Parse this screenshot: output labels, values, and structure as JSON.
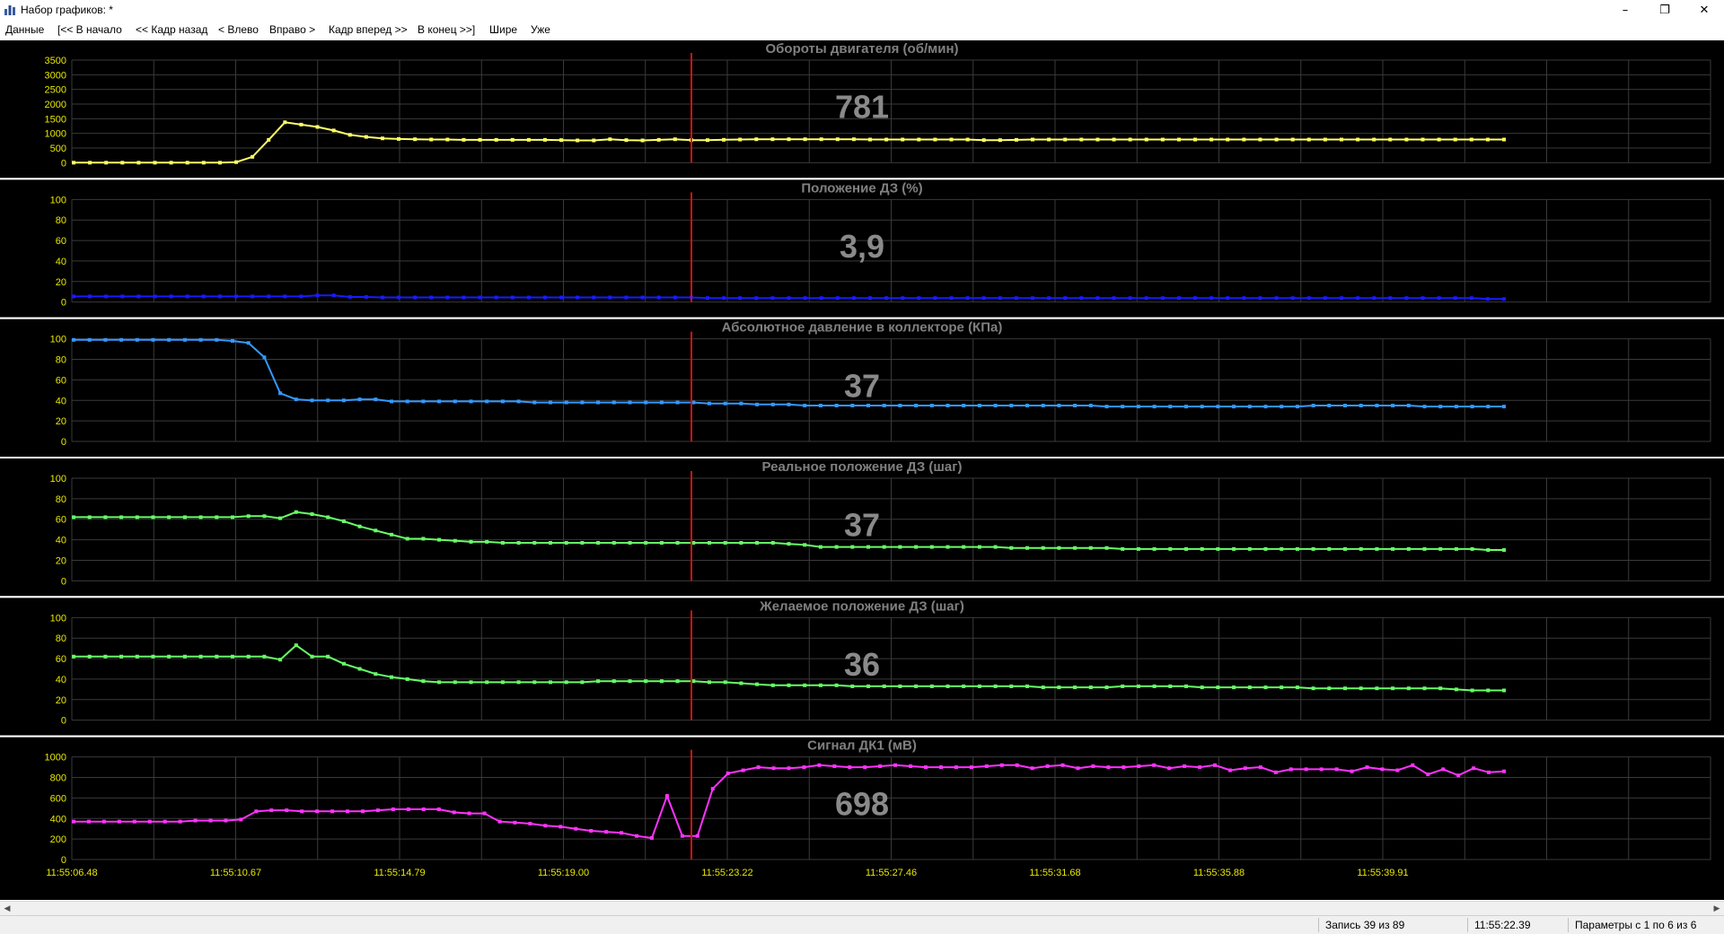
{
  "window": {
    "title": "Набор графиков: *",
    "app_icon": "bar-chart-icon",
    "controls": [
      "minimize-icon",
      "restore-icon",
      "close-icon"
    ]
  },
  "menu": [
    "Данные",
    "[<< В начало",
    "<< Кадр назад",
    "< Влево",
    "Вправо >",
    "Кадр вперед >>",
    "В конец >>]",
    "Шире",
    "Уже"
  ],
  "colors": {
    "plot_background": "#000000",
    "grid": "#3a3a3a",
    "cursor": "#d01010",
    "title_text": "#808080",
    "value_text": "#8a8a8a",
    "tick_text": "#e8e800"
  },
  "cursor_time": "11:55:22.39",
  "x_ticks": [
    "11:55:06.48",
    "11:55:10.67",
    "11:55:14.79",
    "11:55:19.00",
    "11:55:23.22",
    "11:55:27.46",
    "11:55:31.68",
    "11:55:35.88",
    "11:55:39.91"
  ],
  "chart_data": [
    {
      "type": "line",
      "title": "Обороты двигателя  (об/мин)",
      "current_value": "781",
      "color": "#ffff66",
      "ylim": [
        0,
        3500
      ],
      "yticks": [
        0,
        500,
        1000,
        1500,
        2000,
        2500,
        3000,
        3500
      ],
      "x": [
        "11:55:06.48",
        "11:55:10.67",
        "11:55:14.79",
        "11:55:19.00",
        "11:55:23.22",
        "11:55:27.46",
        "11:55:31.68",
        "11:55:35.88",
        "11:55:39.91"
      ],
      "values": [
        0,
        0,
        0,
        0,
        0,
        0,
        0,
        0,
        0,
        0,
        20,
        200,
        780,
        1380,
        1300,
        1220,
        1100,
        950,
        880,
        830,
        810,
        800,
        790,
        790,
        780,
        780,
        780,
        780,
        780,
        780,
        770,
        760,
        760,
        800,
        770,
        760,
        780,
        800,
        770,
        770,
        781,
        790,
        800,
        800,
        800,
        800,
        800,
        800,
        800,
        790,
        790,
        790,
        790,
        790,
        790,
        790,
        770,
        770,
        780,
        790,
        790,
        790,
        790,
        790,
        790,
        790,
        790,
        790,
        790,
        790,
        790,
        790,
        790,
        790,
        790,
        790,
        790,
        790,
        790,
        790,
        790,
        790,
        790,
        790,
        790,
        790,
        790,
        790,
        790
      ]
    },
    {
      "type": "line",
      "title": "Положение ДЗ  (%)",
      "current_value": "3,9",
      "color": "#1a1aff",
      "ylim": [
        0,
        100
      ],
      "yticks": [
        0,
        20,
        40,
        60,
        80,
        100
      ],
      "values": [
        5.5,
        5.5,
        5.5,
        5.5,
        5.5,
        5.5,
        5.5,
        5.5,
        5.5,
        5.5,
        5.5,
        5.5,
        5.5,
        5.5,
        5.5,
        6.5,
        6.5,
        5,
        5,
        4.5,
        4.5,
        4.5,
        4.5,
        4.5,
        4.5,
        4.5,
        4.5,
        4.5,
        4.5,
        4.5,
        4.5,
        4.5,
        4.5,
        4.5,
        4.5,
        4.5,
        4.5,
        4.5,
        4.5,
        3.9,
        3.9,
        3.9,
        3.9,
        3.9,
        3.9,
        3.9,
        3.9,
        3.9,
        3.9,
        3.9,
        3.9,
        3.9,
        3.9,
        3.9,
        3.9,
        3.9,
        3.9,
        3.9,
        3.9,
        3.9,
        3.9,
        3.9,
        3.9,
        3.9,
        3.9,
        3.9,
        3.9,
        3.9,
        3.9,
        3.9,
        3.9,
        3.9,
        3.9,
        3.9,
        3.9,
        3.9,
        3.9,
        3.9,
        3.9,
        3.9,
        3.9,
        3.9,
        3.9,
        3.9,
        3.9,
        3.9,
        3.9,
        3,
        3
      ]
    },
    {
      "type": "line",
      "title": "Абсолютное давление в коллекторе  (КПа)",
      "current_value": "37",
      "color": "#3399ff",
      "ylim": [
        0,
        100
      ],
      "yticks": [
        0,
        20,
        40,
        60,
        80,
        100
      ],
      "values": [
        99,
        99,
        99,
        99,
        99,
        99,
        99,
        99,
        99,
        99,
        98,
        96,
        82,
        47,
        41,
        40,
        40,
        40,
        41,
        41,
        39,
        39,
        39,
        39,
        39,
        39,
        39,
        39,
        39,
        38,
        38,
        38,
        38,
        38,
        38,
        38,
        38,
        38,
        38,
        38,
        37,
        37,
        37,
        36,
        36,
        36,
        35,
        35,
        35,
        35,
        35,
        35,
        35,
        35,
        35,
        35,
        35,
        35,
        35,
        35,
        35,
        35,
        35,
        35,
        35,
        34,
        34,
        34,
        34,
        34,
        34,
        34,
        34,
        34,
        34,
        34,
        34,
        34,
        35,
        35,
        35,
        35,
        35,
        35,
        35,
        34,
        34,
        34,
        34,
        34,
        34
      ]
    },
    {
      "type": "line",
      "title": "Реальное положение ДЗ  (шаг)",
      "current_value": "37",
      "color": "#66ff66",
      "ylim": [
        0,
        100
      ],
      "yticks": [
        0,
        20,
        40,
        60,
        80,
        100
      ],
      "values": [
        62,
        62,
        62,
        62,
        62,
        62,
        62,
        62,
        62,
        62,
        62,
        63,
        63,
        61,
        67,
        65,
        62,
        58,
        53,
        49,
        45,
        41,
        41,
        40,
        39,
        38,
        38,
        37,
        37,
        37,
        37,
        37,
        37,
        37,
        37,
        37,
        37,
        37,
        37,
        37,
        37,
        37,
        37,
        37,
        37,
        36,
        35,
        33,
        33,
        33,
        33,
        33,
        33,
        33,
        33,
        33,
        33,
        33,
        33,
        32,
        32,
        32,
        32,
        32,
        32,
        32,
        31,
        31,
        31,
        31,
        31,
        31,
        31,
        31,
        31,
        31,
        31,
        31,
        31,
        31,
        31,
        31,
        31,
        31,
        31,
        31,
        31,
        31,
        31,
        30,
        30
      ]
    },
    {
      "type": "line",
      "title": "Желаемое положение ДЗ  (шаг)",
      "current_value": "36",
      "color": "#66ff66",
      "ylim": [
        0,
        100
      ],
      "yticks": [
        0,
        20,
        40,
        60,
        80,
        100
      ],
      "values": [
        62,
        62,
        62,
        62,
        62,
        62,
        62,
        62,
        62,
        62,
        62,
        62,
        62,
        59,
        73,
        62,
        62,
        55,
        50,
        45,
        42,
        40,
        38,
        37,
        37,
        37,
        37,
        37,
        37,
        37,
        37,
        37,
        37,
        38,
        38,
        38,
        38,
        38,
        38,
        38,
        37,
        37,
        36,
        35,
        34,
        34,
        34,
        34,
        34,
        33,
        33,
        33,
        33,
        33,
        33,
        33,
        33,
        33,
        33,
        33,
        33,
        32,
        32,
        32,
        32,
        32,
        33,
        33,
        33,
        33,
        33,
        32,
        32,
        32,
        32,
        32,
        32,
        32,
        31,
        31,
        31,
        31,
        31,
        31,
        31,
        31,
        31,
        30,
        29,
        29,
        29
      ]
    },
    {
      "type": "line",
      "title": "Сигнал ДК1  (мВ)",
      "current_value": "698",
      "color": "#ff33ff",
      "ylim": [
        0,
        1000
      ],
      "yticks": [
        0,
        200,
        400,
        600,
        800,
        1000
      ],
      "values": [
        370,
        370,
        370,
        370,
        370,
        370,
        370,
        370,
        380,
        380,
        380,
        390,
        470,
        480,
        480,
        470,
        470,
        470,
        470,
        470,
        480,
        490,
        490,
        490,
        490,
        460,
        450,
        450,
        370,
        360,
        350,
        330,
        320,
        300,
        280,
        270,
        260,
        230,
        210,
        620,
        230,
        230,
        690,
        840,
        870,
        900,
        890,
        890,
        900,
        920,
        910,
        900,
        900,
        910,
        920,
        910,
        900,
        900,
        900,
        900,
        910,
        920,
        920,
        890,
        910,
        920,
        890,
        910,
        900,
        900,
        910,
        920,
        890,
        910,
        900,
        920,
        870,
        890,
        900,
        850,
        880,
        880,
        880,
        880,
        860,
        900,
        880,
        870,
        920,
        830,
        880,
        820,
        890,
        850,
        860
      ]
    }
  ],
  "status": {
    "record": "Запись 39 из 89",
    "time": "11:55:22.39",
    "params": "Параметры с 1 по 6 из 6"
  }
}
